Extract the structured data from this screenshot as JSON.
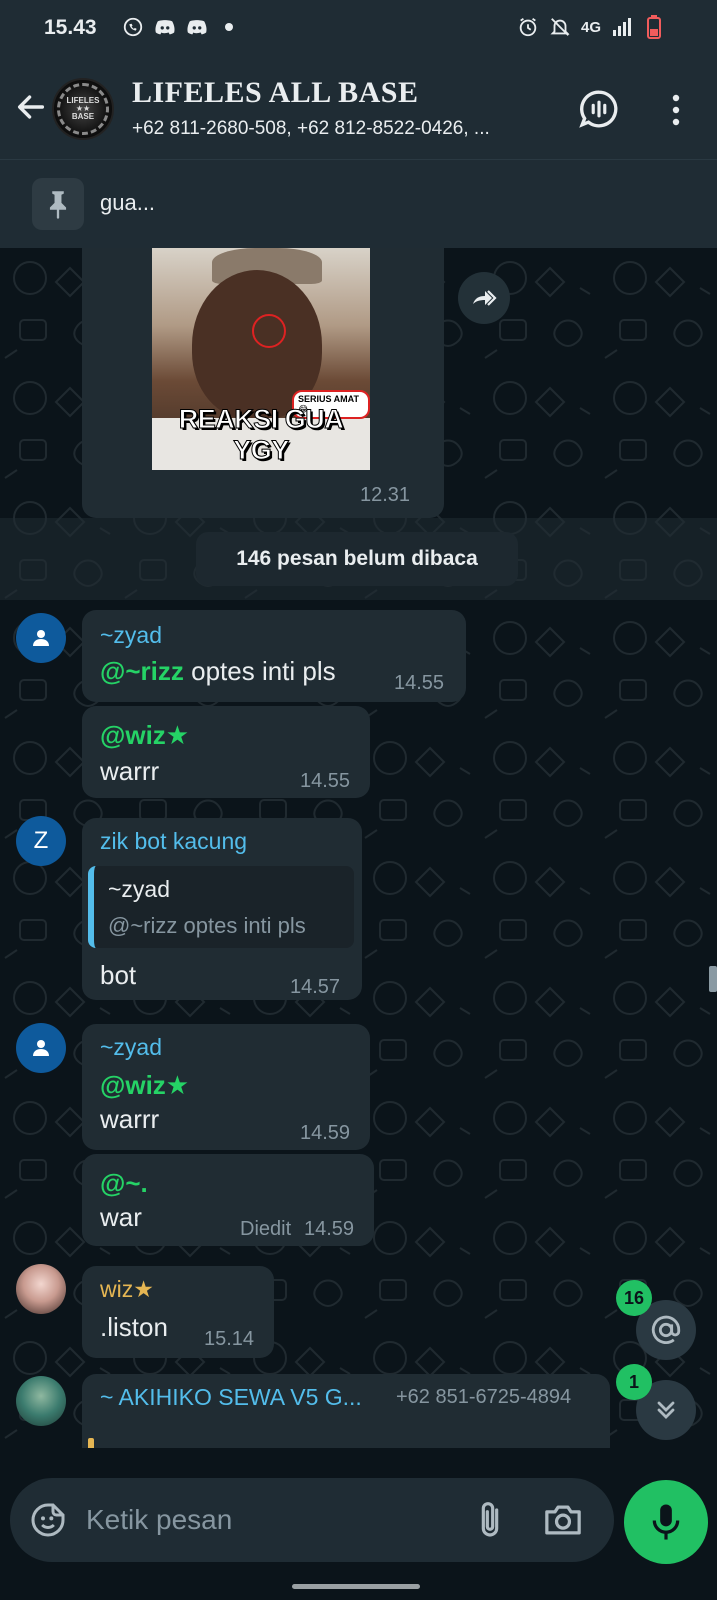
{
  "status_bar": {
    "time": "15.43",
    "network": "4G"
  },
  "header": {
    "title": "LIFELES ALL BASE",
    "subtitle": "+62 811-2680-508, +62 812-8522-0426, ...",
    "avatar_text": "LIFELES ALL BASE"
  },
  "pinned": {
    "text": "gua..."
  },
  "messages": {
    "image_msg": {
      "caption": "REAKSI GUA YGY",
      "tag": "SERIUS AMAT😂",
      "time": "12.31"
    },
    "unread_banner": "146 pesan belum dibaca",
    "m1": {
      "sender": "~zyad",
      "mention": "@~rizz",
      "text": " optes inti pls",
      "time": "14.55"
    },
    "m2": {
      "mention": "@wiz★",
      "text": "warrr",
      "time": "14.55"
    },
    "m3": {
      "avatar_letter": "Z",
      "sender": "zik bot kacung",
      "quote_name": "~zyad",
      "quote_text": "@~rizz optes inti pls",
      "text": "bot",
      "time": "14.57"
    },
    "m4": {
      "sender": "~zyad",
      "mention": "@wiz★",
      "text": "warrr",
      "time": "14.59"
    },
    "m5": {
      "mention": "@~.",
      "text": "war",
      "edited": "Diedit",
      "time": "14.59"
    },
    "m6": {
      "sender": "wiz★",
      "text": ".liston",
      "time": "15.14"
    },
    "m7": {
      "sender": "~ AKIHIKO SEWA V5 G...",
      "phone": "+62 851-6725-4894"
    }
  },
  "floating": {
    "mentions_count": "16",
    "unread_count": "1"
  },
  "input": {
    "placeholder": "Ketik pesan"
  },
  "colors": {
    "accent": "#21c063",
    "bubble": "#202c33",
    "background": "#0b141a",
    "sender_blue": "#53bdeb",
    "sender_yellow": "#e5b653"
  }
}
